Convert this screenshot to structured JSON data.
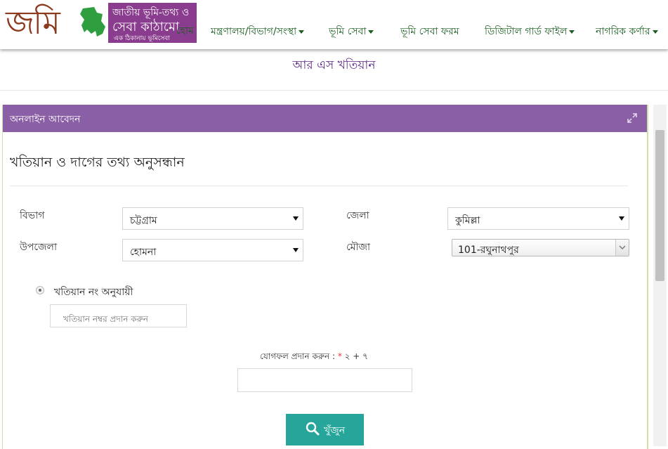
{
  "header": {
    "logo_word": "জমি",
    "logo_line1": "জাতীয় ভূমি-তথ্য ও",
    "logo_line2": "সেবা কাঠামো",
    "logo_tagline": "এক ঠিকানায় ভূমিসেবা",
    "nav": [
      {
        "label": "হোম",
        "dropdown": false
      },
      {
        "label": "মন্ত্রণালয়/বিভাগ/সংস্থা",
        "dropdown": true
      },
      {
        "label": "ভূমি সেবা",
        "dropdown": true
      },
      {
        "label": "ভূমি সেবা ফরম",
        "dropdown": false
      },
      {
        "label": "ডিজিটাল গার্ড ফাইল",
        "dropdown": true
      },
      {
        "label": "নাগরিক কর্ণার",
        "dropdown": true
      }
    ]
  },
  "page_title": "আর এস খতিয়ান",
  "panel": {
    "title": "অনলাইন আবেদন",
    "section_title": "খতিয়ান ও দাগের তথ্য অনুসন্ধান"
  },
  "form": {
    "division_label": "বিভাগ",
    "division_value": "চট্টগ্রাম",
    "district_label": "জেলা",
    "district_value": "কুমিল্লা",
    "upazila_label": "উপজেলা",
    "upazila_value": "হোমনা",
    "mouza_label": "মৌজা",
    "mouza_value": "101-রঘুনাথপুর",
    "radio_label": "খতিয়ান নং অনুযায়ী",
    "khatian_placeholder": "খতিয়ান নম্বর প্রদান করুন",
    "captcha_label": "যোগফল প্রদান করুন :",
    "captcha_required": "*",
    "captcha_question": "২ + ৭",
    "search_label": "খুঁজুন"
  },
  "colors": {
    "panel_header": "#8b5fa5",
    "logo_box": "#8a3d8e",
    "nav_text": "#1b5e20",
    "search_button": "#26a69a",
    "page_title": "#5b2a86"
  }
}
